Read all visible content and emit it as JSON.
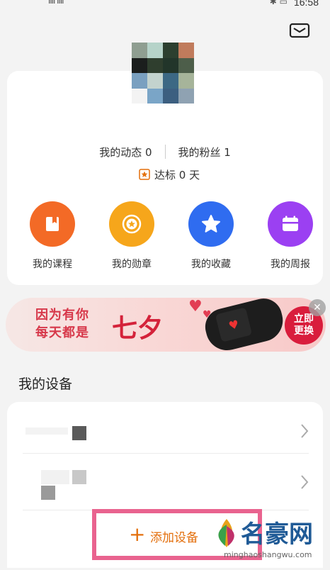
{
  "status_bar": {
    "time": "16:58",
    "signal_left": "ııll ııll",
    "status_right": "✱ ▭"
  },
  "profile": {
    "avatar_colors": [
      "#8f9e91",
      "#b6d3c9",
      "#2c3f2f",
      "#c07b5c",
      "#1b1e1d",
      "#2f3e2e",
      "#22352a",
      "#4d5e4a",
      "#7aa0c0",
      "#c3d3ce",
      "#3c6884",
      "#a6b49a",
      "#f3f3f3",
      "#7aa5c7",
      "#3c5f80",
      "#8fa2b2"
    ],
    "dynamics_label": "我的动态 0",
    "fans_label": "我的粉丝 1",
    "streak_label": "达标 0 天"
  },
  "shortcuts": [
    {
      "label": "我的课程",
      "color": "#f36a26",
      "icon": "book-icon"
    },
    {
      "label": "我的勋章",
      "color": "#f6a61b",
      "icon": "medal-icon"
    },
    {
      "label": "我的收藏",
      "color": "#2f6cf0",
      "icon": "star-icon"
    },
    {
      "label": "我的周报",
      "color": "#9b40f2",
      "icon": "calendar-icon"
    }
  ],
  "banner": {
    "line1": "因为有你",
    "line2": "每天都是",
    "title": "七夕",
    "button_line1": "立即",
    "button_line2": "更换"
  },
  "devices": {
    "section_title": "我的设备",
    "add_label": "添加设备"
  },
  "watermark": {
    "title": "名豪网",
    "url": "minghaoshangwu.com"
  },
  "colors": {
    "accent_orange": "#e36f0c",
    "highlight_pink": "#e9638f",
    "banner_red": "#d91d3c"
  }
}
